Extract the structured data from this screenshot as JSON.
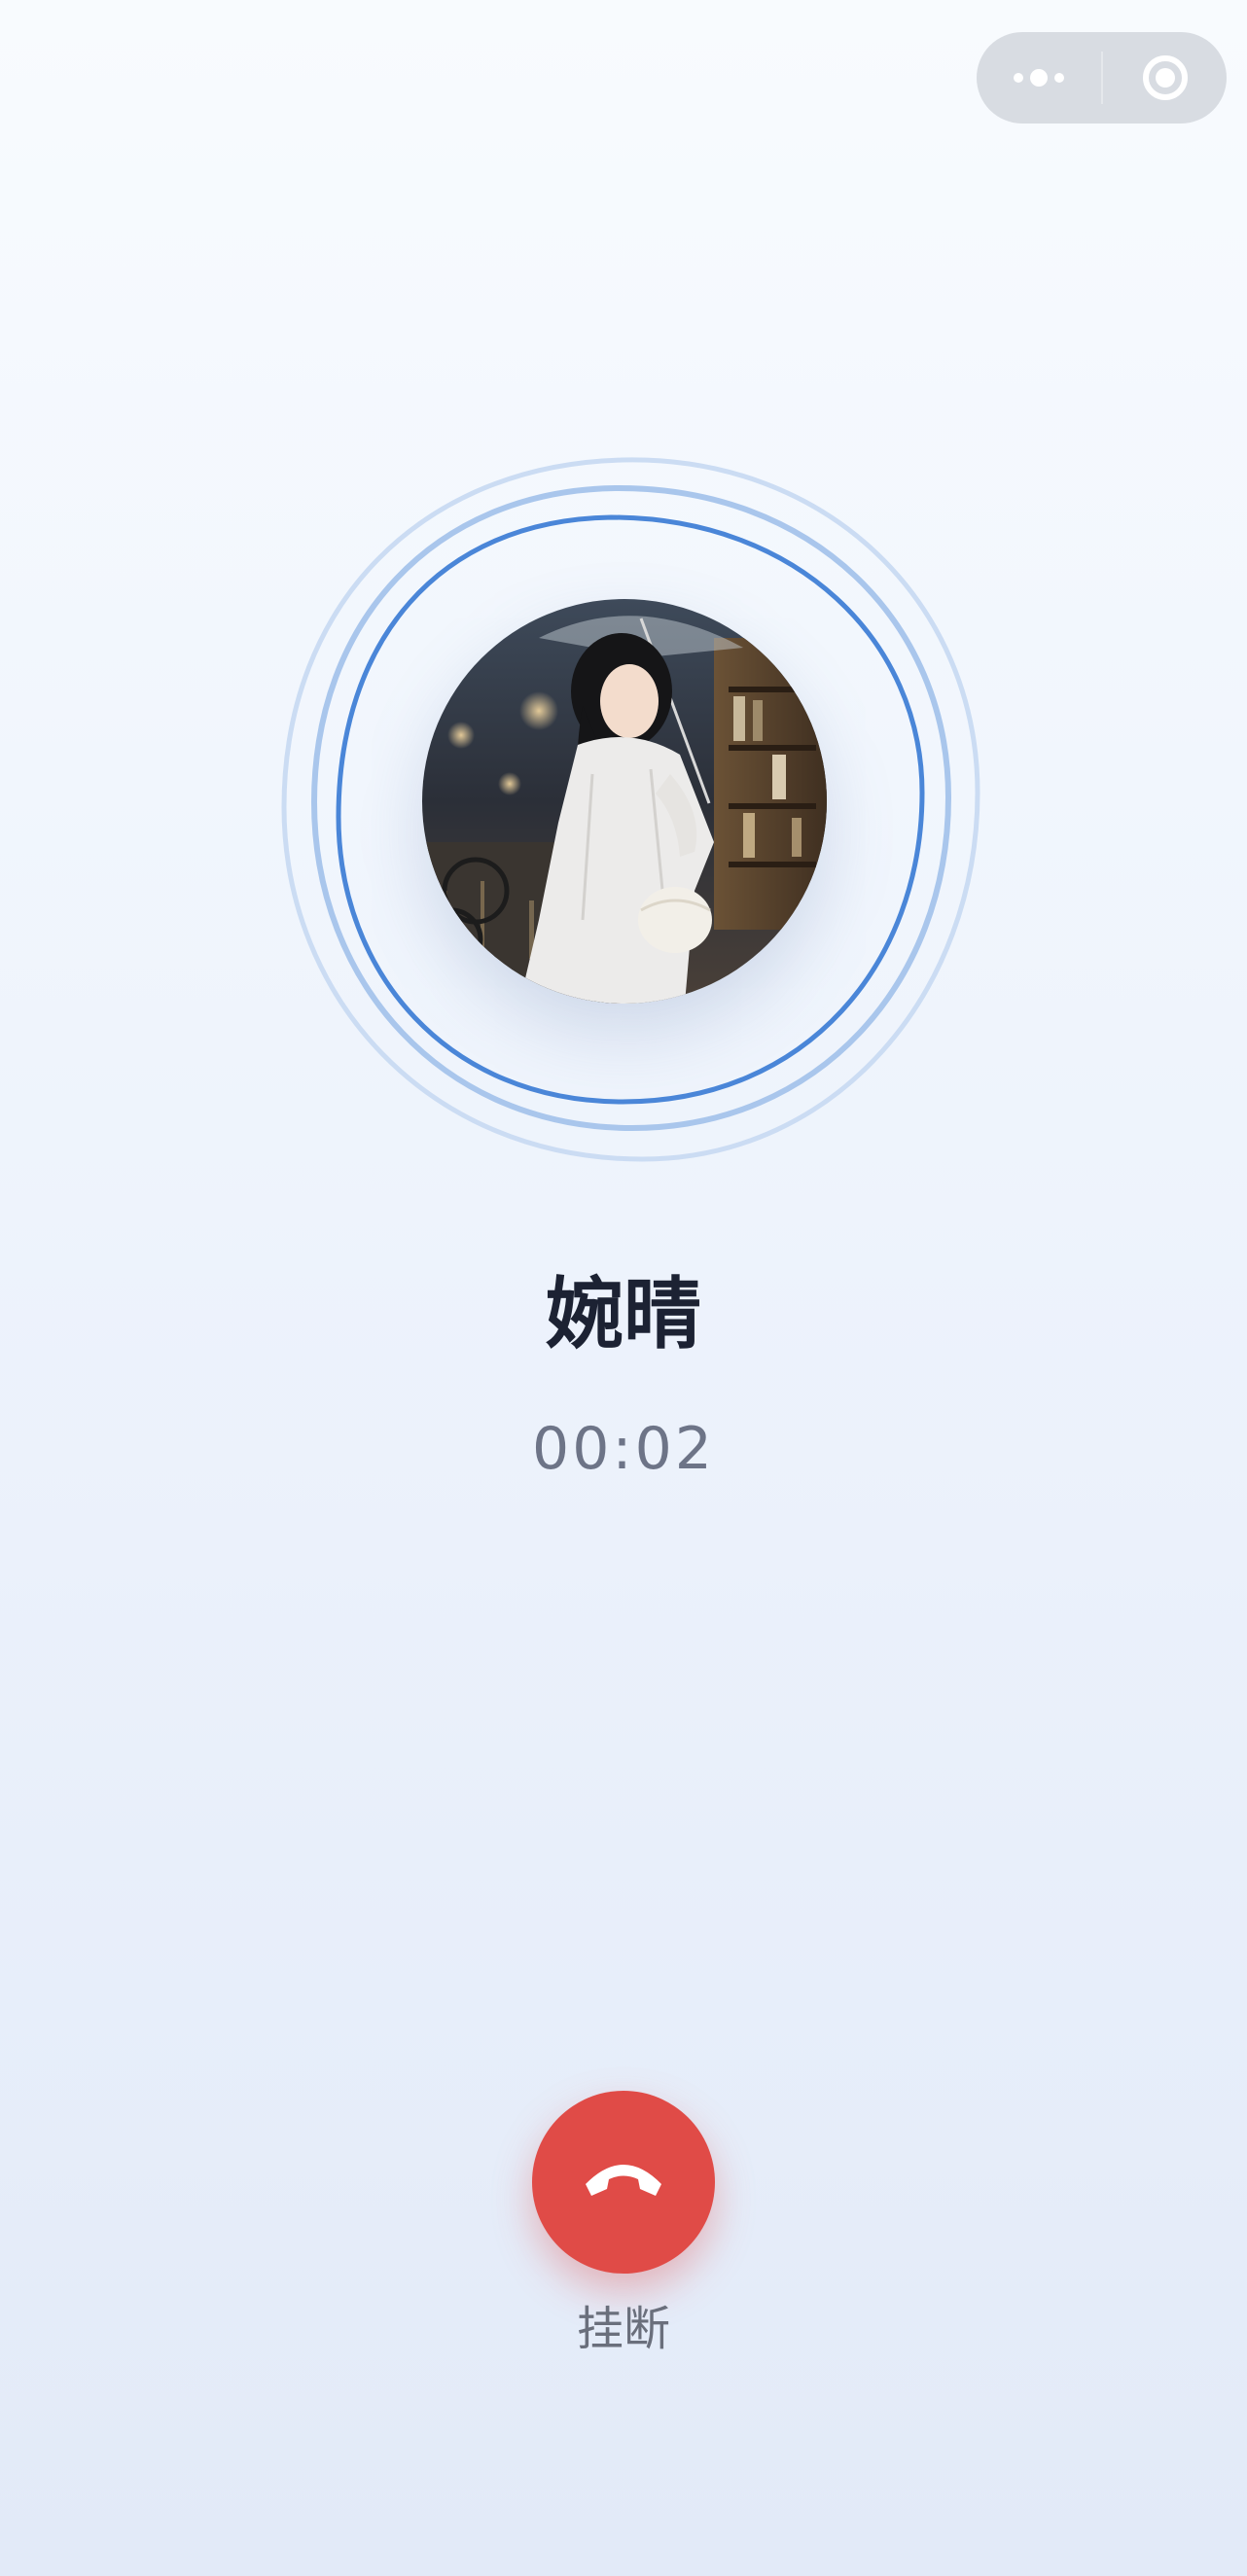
{
  "capsule": {
    "more_icon": "more-dots-icon",
    "close_icon": "record-close-icon"
  },
  "call": {
    "contact_name": "婉晴",
    "duration": "00:02",
    "avatar": "contact-avatar-photo"
  },
  "actions": {
    "hangup_label": "挂断",
    "hangup_icon": "phone-hangup-icon"
  },
  "colors": {
    "ring_primary": "#4a86d8",
    "ring_secondary": "#a9c6ec",
    "hangup": "#e04b47"
  }
}
